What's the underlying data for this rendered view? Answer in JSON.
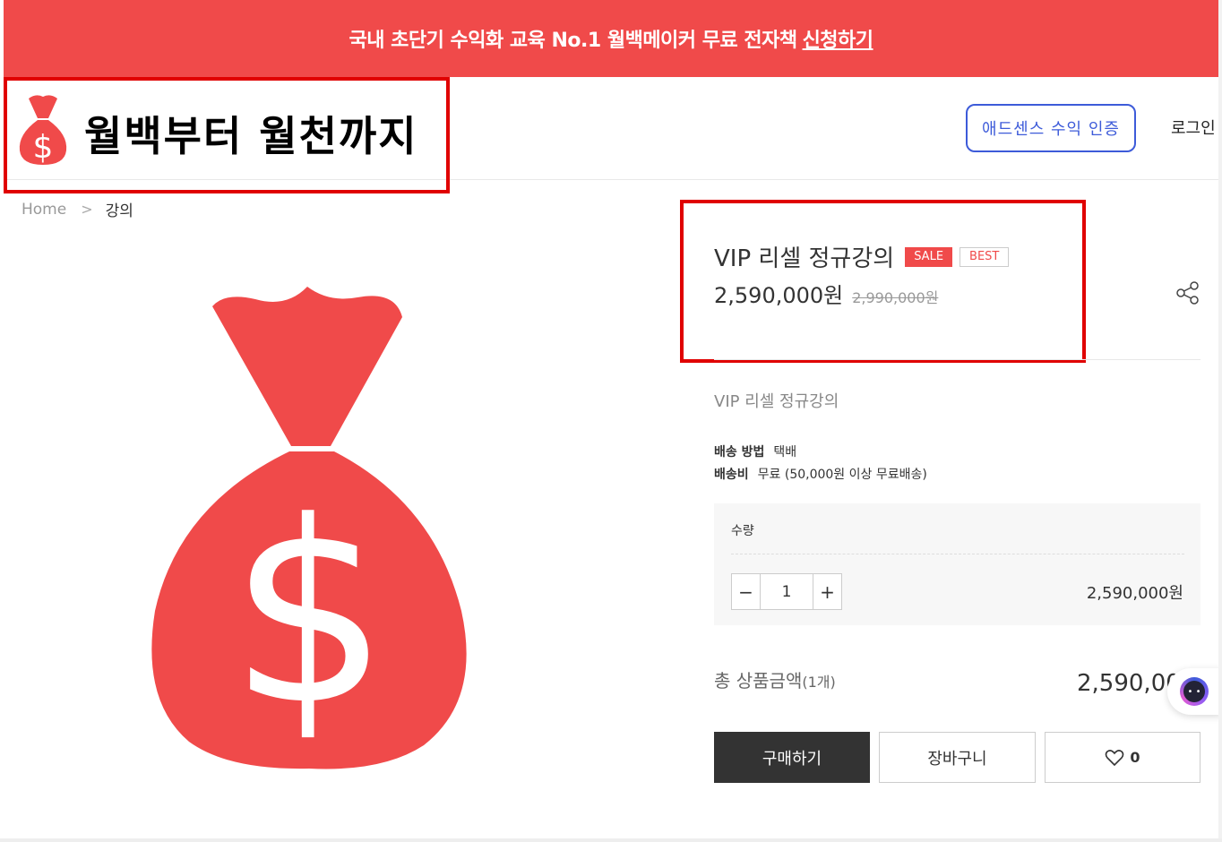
{
  "banner": {
    "text": "국내 초단기 수익화 교육 No.1 월백메이커 무료 전자책",
    "link_label": "신청하기"
  },
  "header": {
    "logo_text": "월백부터 월천까지",
    "adsense_label": "애드센스 수익 인증",
    "login_label": "로그인"
  },
  "breadcrumb": {
    "home": "Home",
    "separator": ">",
    "current": "강의"
  },
  "product": {
    "title": "VIP 리셀 정규강의",
    "badge_sale": "SALE",
    "badge_best": "BEST",
    "price": "2,590,000원",
    "original_price": "2,990,000원",
    "subtitle": "VIP 리셀 정규강의",
    "shipping_method_label": "배송 방법",
    "shipping_method_value": "택배",
    "shipping_fee_label": "배송비",
    "shipping_fee_value": "무료 (50,000원 이상 무료배송)"
  },
  "quantity": {
    "label": "수량",
    "minus": "−",
    "value": "1",
    "plus": "+",
    "line_price": "2,590,000원"
  },
  "total": {
    "label": "총 상품금액",
    "count": "(1개)",
    "value": "2,590,000원"
  },
  "actions": {
    "buy_label": "구매하기",
    "cart_label": "장바구니",
    "wish_count": "0"
  },
  "colors": {
    "accent_red": "#f04a4a",
    "highlight_border": "#e00000",
    "adsense_blue": "#3d5bd9",
    "buy_dark": "#333333"
  },
  "icons": {
    "logo": "money-bag-icon",
    "product_image": "money-bag-icon",
    "share": "share-icon",
    "wish": "heart-icon",
    "chat": "chat-bot-icon"
  }
}
